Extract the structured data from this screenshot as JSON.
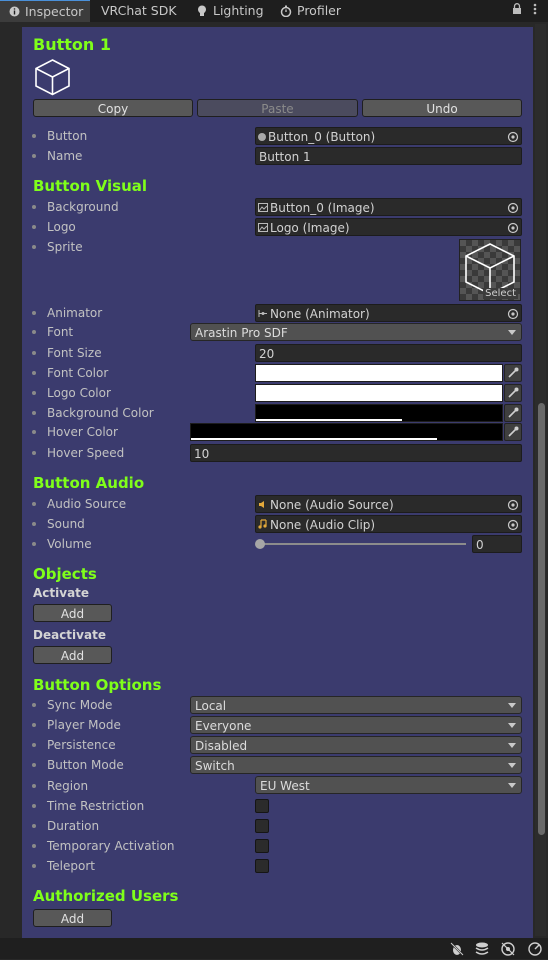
{
  "tabs": [
    {
      "label": "Inspector",
      "icon": "info-icon",
      "active": true
    },
    {
      "label": "VRChat SDK",
      "icon": "",
      "active": false
    },
    {
      "label": "Lighting",
      "icon": "lightbulb-icon",
      "active": false
    },
    {
      "label": "Profiler",
      "icon": "stopwatch-icon",
      "active": false
    }
  ],
  "header": {
    "title": "Button 1",
    "copy_label": "Copy",
    "paste_label": "Paste",
    "undo_label": "Undo"
  },
  "props": {
    "button_label": "Button",
    "button_value": "Button_0 (Button)",
    "name_label": "Name",
    "name_value": "Button 1"
  },
  "visual": {
    "title": "Button Visual",
    "background_label": "Background",
    "background_value": "Button_0 (Image)",
    "logo_label": "Logo",
    "logo_value": "Logo (Image)",
    "sprite_label": "Sprite",
    "sprite_select": "Select",
    "animator_label": "Animator",
    "animator_value": "None (Animator)",
    "font_label": "Font",
    "font_value": "Arastin Pro SDF",
    "font_size_label": "Font Size",
    "font_size_value": "20",
    "font_color_label": "Font Color",
    "font_color": "#ffffff",
    "logo_color_label": "Logo Color",
    "logo_color": "#ffffff",
    "bg_color_label": "Background Color",
    "bg_color": "#000000",
    "hover_color_label": "Hover Color",
    "hover_color": "#000000",
    "hover_speed_label": "Hover Speed",
    "hover_speed_value": "10"
  },
  "audio": {
    "title": "Button Audio",
    "source_label": "Audio Source",
    "source_value": "None (Audio Source)",
    "sound_label": "Sound",
    "sound_value": "None (Audio Clip)",
    "volume_label": "Volume",
    "volume_value": "0"
  },
  "objects": {
    "title": "Objects",
    "activate_label": "Activate",
    "activate_add": "Add",
    "deactivate_label": "Deactivate",
    "deactivate_add": "Add"
  },
  "options": {
    "title": "Button Options",
    "sync_label": "Sync Mode",
    "sync_value": "Local",
    "player_label": "Player Mode",
    "player_value": "Everyone",
    "persist_label": "Persistence",
    "persist_value": "Disabled",
    "mode_label": "Button Mode",
    "mode_value": "Switch",
    "region_label": "Region",
    "region_value": "EU West",
    "time_label": "Time Restriction",
    "duration_label": "Duration",
    "temp_label": "Temporary Activation",
    "teleport_label": "Teleport"
  },
  "auth": {
    "title": "Authorized Users",
    "add": "Add"
  },
  "colors": {
    "panel": "#3b3b6e",
    "heading": "#7fff1a"
  }
}
